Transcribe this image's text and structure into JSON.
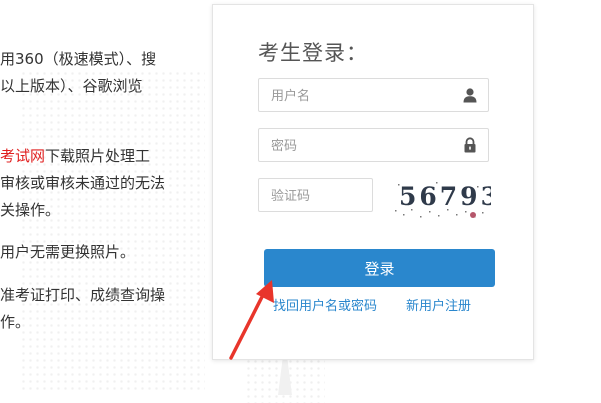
{
  "notes": [
    {
      "text": "用360（极速模式）、搜"
    },
    {
      "text": "以上版本）、谷歌浏览"
    },
    {
      "highlight": "考试网",
      "text": "下载照片处理工"
    },
    {
      "text": "审核或审核未通过的无法"
    },
    {
      "text": "关操作。"
    },
    {
      "text": "用户无需更换照片。"
    },
    {
      "text": "准考证打印、成绩查询操"
    },
    {
      "text": "作。"
    }
  ],
  "login": {
    "title": "考生登录：",
    "username_placeholder": "用户名",
    "password_placeholder": "密码",
    "captcha_placeholder": "验证码",
    "captcha_text": "56793",
    "submit_label": "登录",
    "forgot_link": "找回用户名或密码",
    "register_link": "新用户注册"
  },
  "colors": {
    "accent": "#2a87cd",
    "highlight_red": "#e02020",
    "arrow_red": "#e8352b"
  }
}
